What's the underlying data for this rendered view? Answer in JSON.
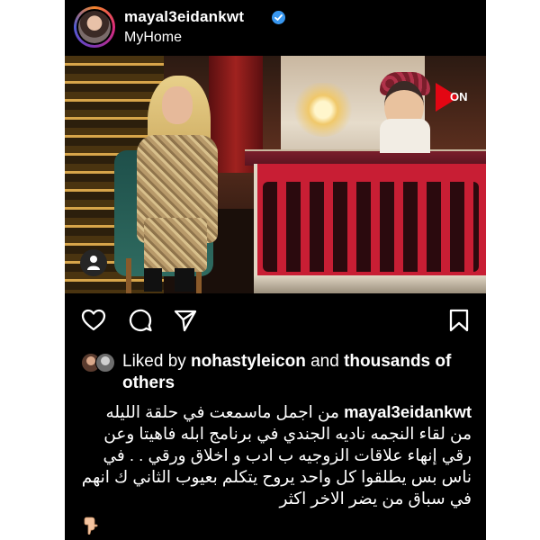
{
  "post": {
    "username": "mayal3eidankwt",
    "verified": true,
    "location": "MyHome",
    "media": {
      "channel_logo_text": "ON"
    },
    "likes": {
      "prefix": "Liked by ",
      "liker": "nohastyleicon",
      "middle": " and ",
      "suffix": "thousands of others"
    },
    "caption": {
      "username": "mayal3eidankwt",
      "text": "من اجمل ماسمعت في حلقة الليله من لقاء النجمه ناديه الجندي في برنامج ابله فاهيتا وعن رقي إنهاء علاقات الزوجيه ب ادب و اخلاق ورقي . . في ناس بس يطلقوا كل واحد يروح يتكلم بعيوب الثاني ك انهم في سباق من يضر الاخر اكثر"
    },
    "icons": {
      "like": "heart-icon",
      "comment": "comment-icon",
      "share": "send-icon",
      "save": "bookmark-icon",
      "tag": "user-tag-icon",
      "verified": "verified-badge-icon",
      "caption_end": "pointing-down-emoji-icon"
    },
    "colors": {
      "background": "#000000",
      "text": "#ffffff",
      "verified": "#3897f0",
      "channel_logo": "#e30613"
    }
  }
}
